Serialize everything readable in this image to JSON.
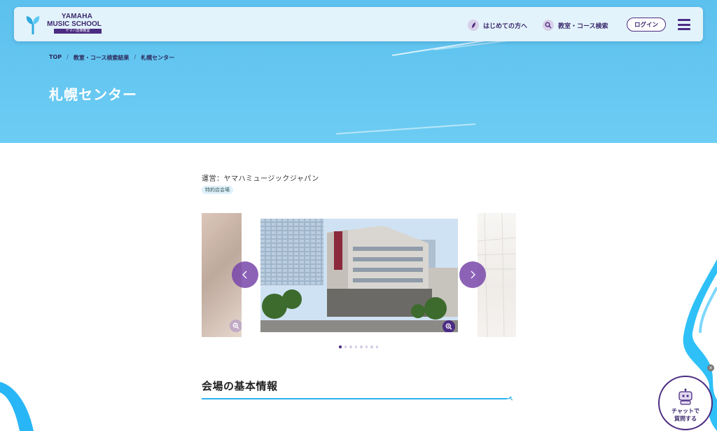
{
  "header": {
    "logo": {
      "line1": "YAMAHA",
      "line2": "MUSIC SCHOOL",
      "line3": "ヤマハ音楽教室"
    },
    "nav": [
      {
        "label": "はじめての方へ",
        "icon": "leaf-icon"
      },
      {
        "label": "教室・コース検索",
        "icon": "search-icon"
      }
    ],
    "login_label": "ログイン",
    "menu_icon": "hamburger-menu-icon"
  },
  "breadcrumb": [
    "TOP",
    "教室・コース検索結果",
    "札幌センター"
  ],
  "page_title": "札幌センター",
  "operator": "運営：ヤマハミュージックジャパン",
  "tag": "特約店会場",
  "carousel": {
    "slide_count": 8,
    "active_index": 0,
    "prev_icon": "chevron-left-icon",
    "next_icon": "chevron-right-icon",
    "zoom_icon": "zoom-in-icon"
  },
  "section": {
    "title": "会場の基本情報"
  },
  "chat": {
    "line1": "チャットで",
    "line2": "質問する",
    "close": "×"
  },
  "colors": {
    "brand_purple": "#4b2c83",
    "hero_blue": "#5cc1ee",
    "accent_cyan": "#29b6f6"
  }
}
